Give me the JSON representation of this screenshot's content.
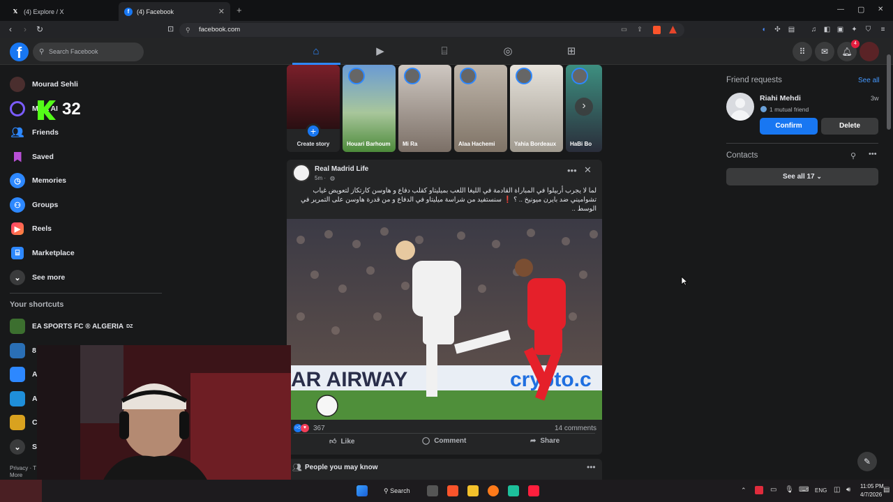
{
  "browser": {
    "tabs": [
      {
        "title": "(4) Explore / X",
        "icon": "x-logo-icon"
      },
      {
        "title": "(4) Facebook",
        "icon": "facebook-logo-icon"
      }
    ],
    "url": "facebook.com",
    "new_tab": "+",
    "win_min": "—",
    "win_max": "▢",
    "win_close": "✕"
  },
  "fb": {
    "logo": "f",
    "search_placeholder": "Search Facebook",
    "notif_count": "4"
  },
  "sidebar": {
    "items": [
      {
        "label": "Mourad Sehli"
      },
      {
        "label": "Meta AI"
      },
      {
        "label": "Friends"
      },
      {
        "label": "Saved"
      },
      {
        "label": "Memories"
      },
      {
        "label": "Groups"
      },
      {
        "label": "Reels"
      },
      {
        "label": "Marketplace"
      },
      {
        "label": "See more"
      }
    ],
    "overlay_number": "32",
    "shortcuts_title": "Your shortcuts",
    "shortcuts": [
      {
        "label": "EA SPORTS FC ® ALGERIA",
        "suffix": "DZ"
      },
      {
        "label": "8"
      },
      {
        "label": "A"
      },
      {
        "label": "A"
      },
      {
        "label": "C"
      },
      {
        "label": "Se"
      }
    ],
    "footer_line1": "Privacy · T",
    "footer_line2": "More"
  },
  "stories": [
    {
      "name": "Create story"
    },
    {
      "name": "Houari Barhoum"
    },
    {
      "name": "Mi Ra"
    },
    {
      "name": "Alaa Hachemi"
    },
    {
      "name": "Yahia Bordeaux"
    },
    {
      "name": "HaBi Bo"
    }
  ],
  "post": {
    "author": "Real Madrid Life",
    "time": "5m ·",
    "text": "لما لا يجرب أربيلوا في المباراة القادمة في الليغا اللعب بميليتاو كقلب دفاع و هاوسن كارتكاز لتعويض غياب تشواميني ضد بايرن ميونيخ .. ؟ ❗ سنستفيد من شراسة ميليتاو في الدفاع و من قدرة هاوسن على التمرير في الوسط ..",
    "reactions": "367",
    "comments": "14 comments",
    "like": "Like",
    "comment": "Comment",
    "share": "Share",
    "photo_banner": "AR AIRWAY",
    "photo_banner2": "crypto.c"
  },
  "pymk_title": "People you may know",
  "right": {
    "friend_requests": "Friend requests",
    "see_all": "See all",
    "requester": "Riahi Mehdi",
    "mutual": "1 mutual friend",
    "age": "3w",
    "confirm": "Confirm",
    "delete": "Delete",
    "contacts": "Contacts",
    "see_all_contacts": "See all 17"
  },
  "taskbar": {
    "search": "Search",
    "lang": "ENG",
    "time": "11:05 PM",
    "date": "4/7/2026"
  },
  "colors": {
    "accent": "#1877f2",
    "bg": "#18191a",
    "card": "#242526"
  }
}
